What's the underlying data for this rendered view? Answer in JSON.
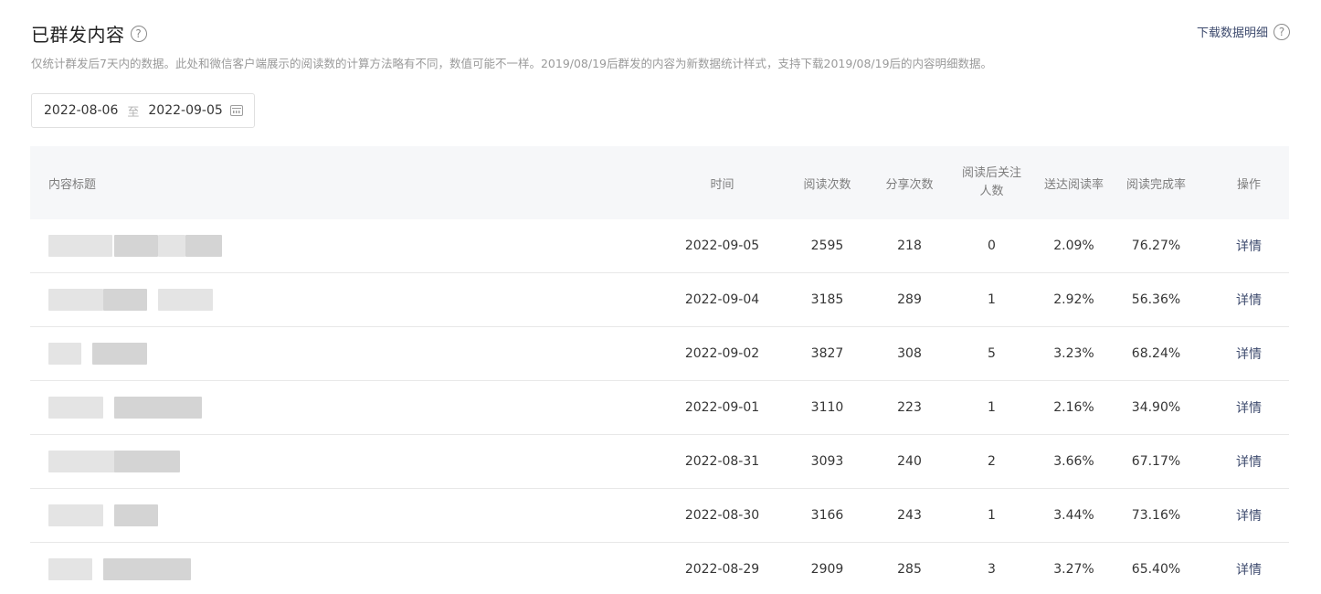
{
  "header": {
    "title": "已群发内容",
    "help_glyph": "?",
    "download_label": "下载数据明细",
    "description": "仅统计群发后7天内的数据。此处和微信客户端展示的阅读数的计算方法略有不同，数值可能不一样。2019/08/19后群发的内容为新数据统计样式，支持下载2019/08/19后的内容明细数据。"
  },
  "date_range": {
    "start": "2022-08-06",
    "separator": "至",
    "end": "2022-09-05"
  },
  "table": {
    "columns": [
      "内容标题",
      "时间",
      "阅读次数",
      "分享次数",
      "阅读后关注人数",
      "送达阅读率",
      "阅读完成率",
      "操作"
    ],
    "column_follow_line1": "阅读后关注",
    "column_follow_line2": "人数",
    "rows": [
      {
        "time": "2022-09-05",
        "reads": "2595",
        "shares": "218",
        "follows": "0",
        "delivery_rate": "2.09%",
        "completion_rate": "76.27%",
        "action": "详情"
      },
      {
        "time": "2022-09-04",
        "reads": "3185",
        "shares": "289",
        "follows": "1",
        "delivery_rate": "2.92%",
        "completion_rate": "56.36%",
        "action": "详情"
      },
      {
        "time": "2022-09-02",
        "reads": "3827",
        "shares": "308",
        "follows": "5",
        "delivery_rate": "3.23%",
        "completion_rate": "68.24%",
        "action": "详情"
      },
      {
        "time": "2022-09-01",
        "reads": "3110",
        "shares": "223",
        "follows": "1",
        "delivery_rate": "2.16%",
        "completion_rate": "34.90%",
        "action": "详情"
      },
      {
        "time": "2022-08-31",
        "reads": "3093",
        "shares": "240",
        "follows": "2",
        "delivery_rate": "3.66%",
        "completion_rate": "67.17%",
        "action": "详情"
      },
      {
        "time": "2022-08-30",
        "reads": "3166",
        "shares": "243",
        "follows": "1",
        "delivery_rate": "3.44%",
        "completion_rate": "73.16%",
        "action": "详情"
      },
      {
        "time": "2022-08-29",
        "reads": "2909",
        "shares": "285",
        "follows": "3",
        "delivery_rate": "3.27%",
        "completion_rate": "65.40%",
        "action": "详情"
      }
    ]
  }
}
